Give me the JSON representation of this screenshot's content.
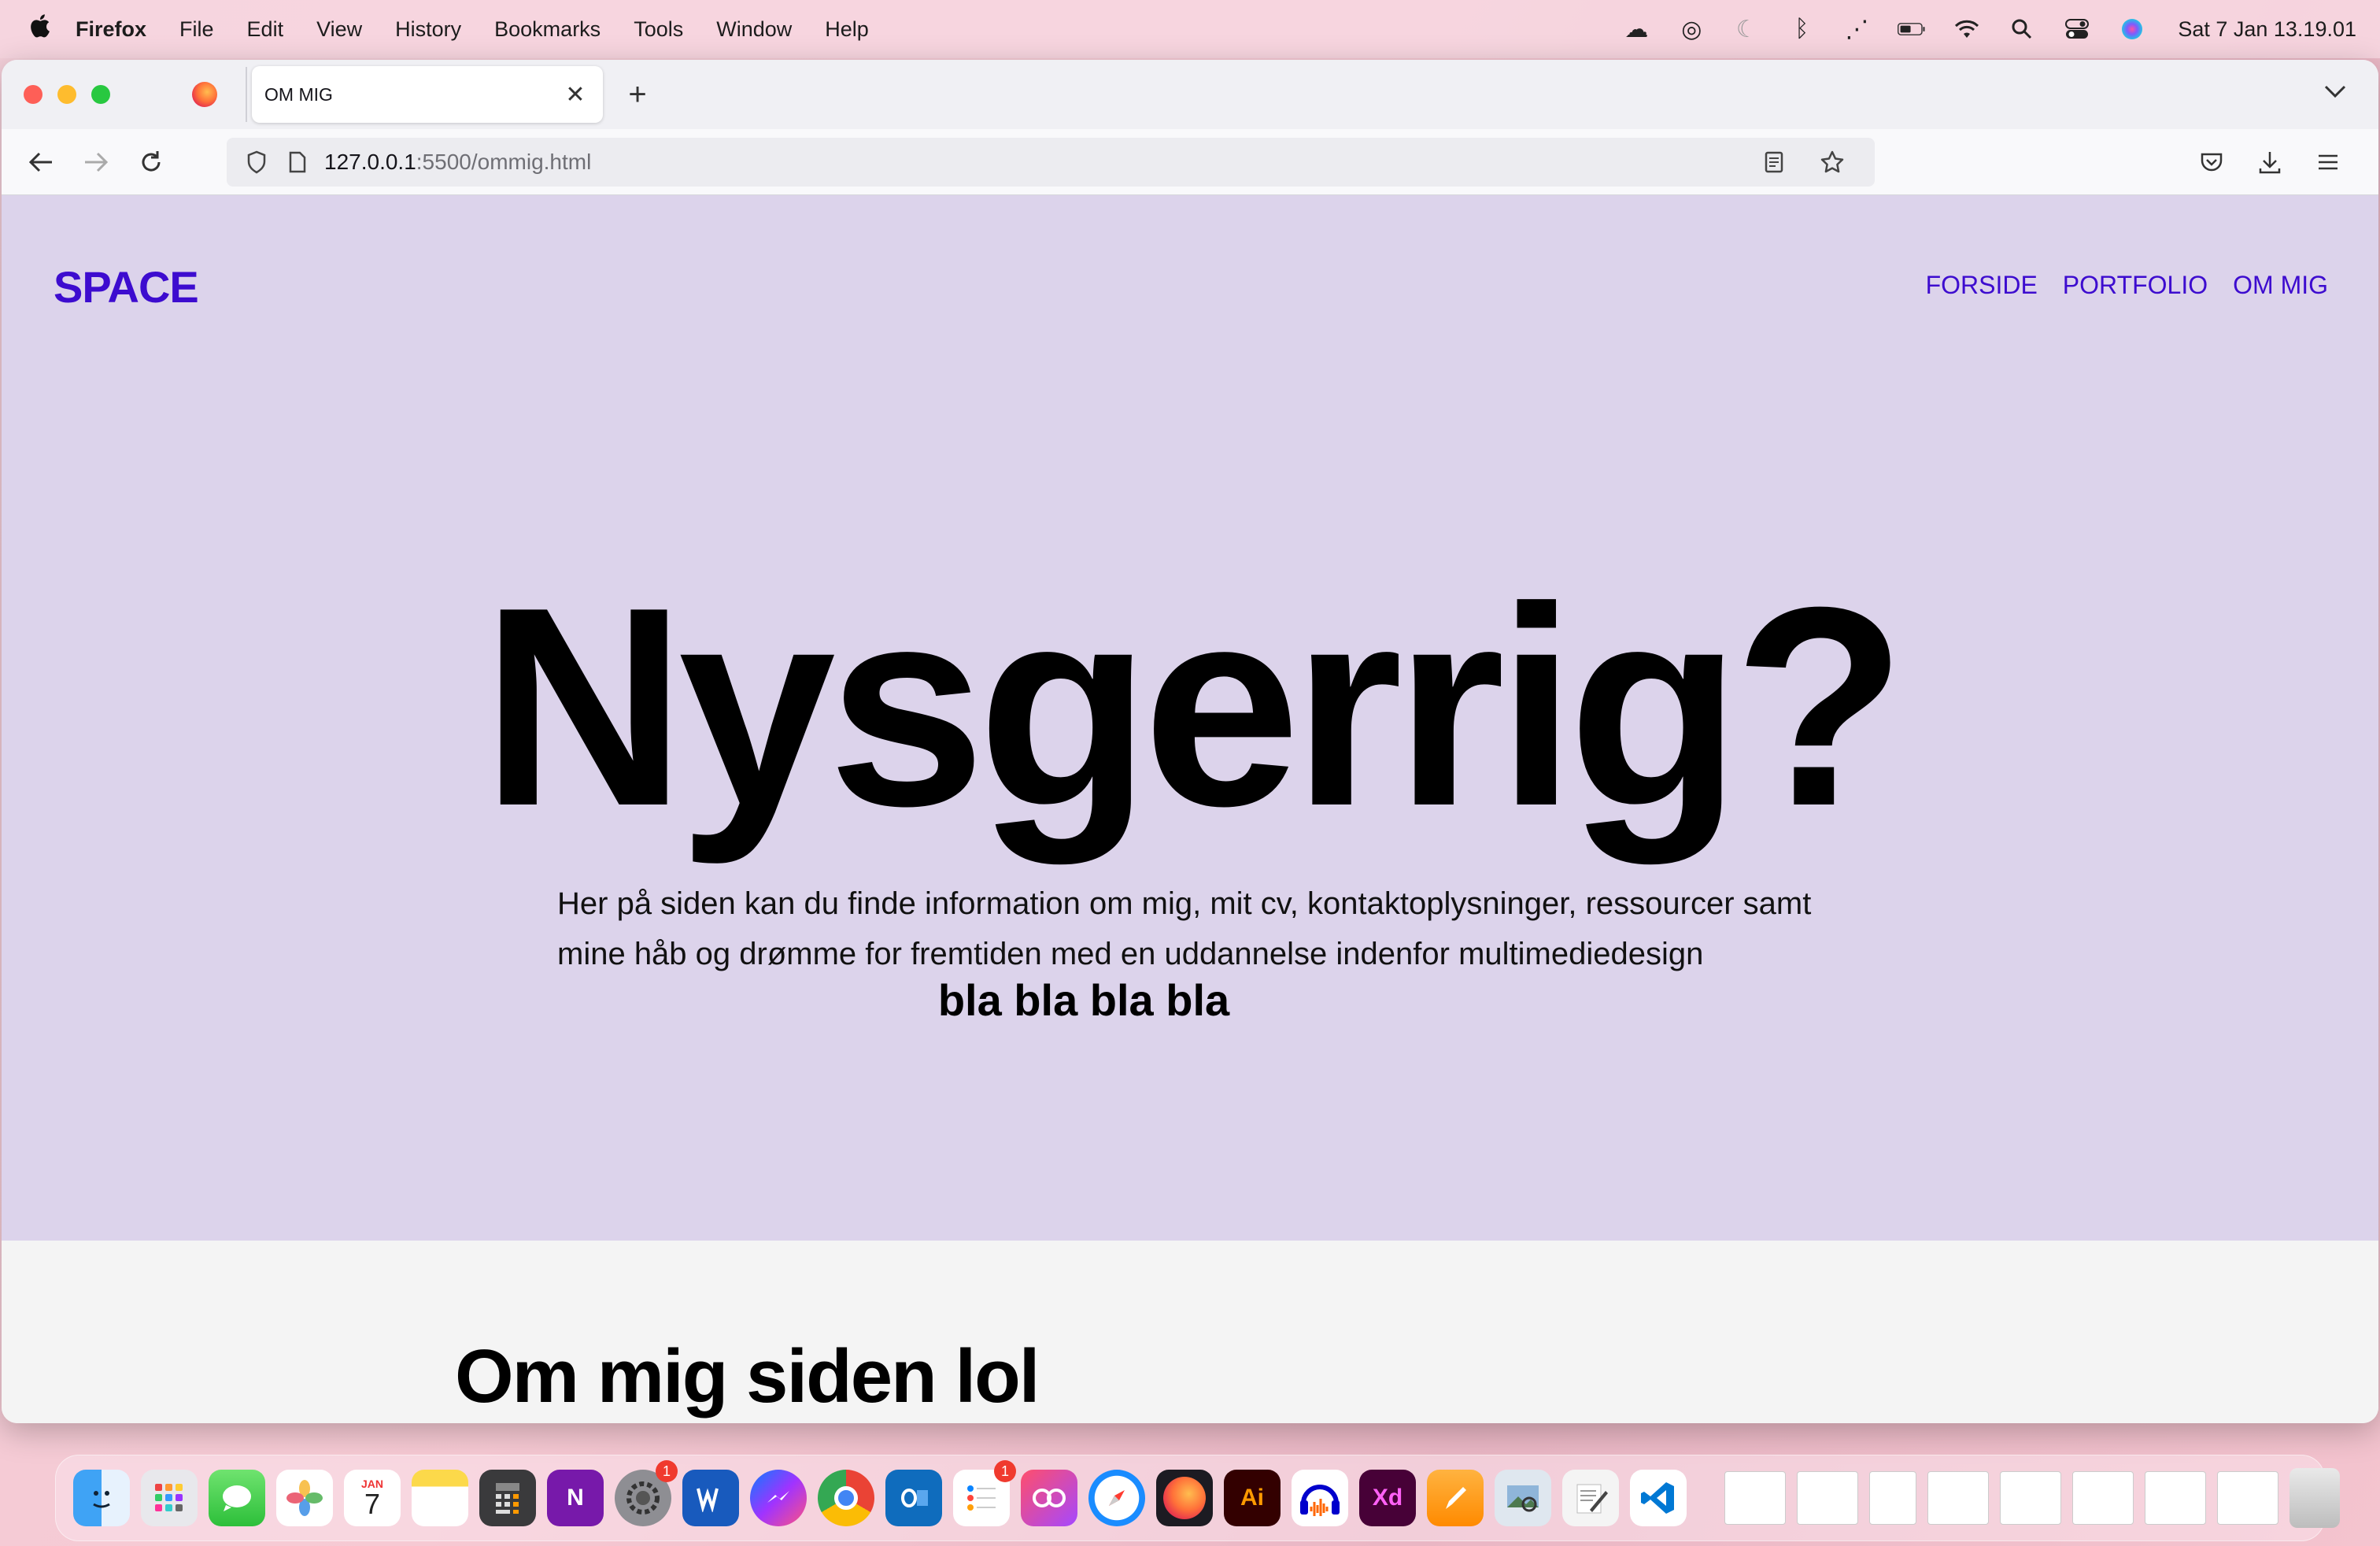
{
  "menubar": {
    "apple": "",
    "app_name": "Firefox",
    "items": [
      "File",
      "Edit",
      "View",
      "History",
      "Bookmarks",
      "Tools",
      "Window",
      "Help"
    ],
    "clock": "Sat 7 Jan  13.19.01"
  },
  "browser": {
    "tab_title": "OM MIG",
    "tab_close": "✕",
    "new_tab": "+",
    "url_host": "127.0.0.1",
    "url_path": ":5500/ommig.html"
  },
  "site": {
    "logo": "SPACE",
    "nav": [
      "FORSIDE",
      "PORTFOLIO",
      "OM MIG"
    ],
    "hero_title": "Nysgerrig?",
    "hero_text": "Her på siden kan du finde information om mig, mit cv, kontaktoplysninger, ressourcer samt mine håb og drømme for fremtiden med en uddannelse indenfor multimediedesign",
    "hero_strong": "bla bla bla bla",
    "section_heading": "Om mig siden lol"
  },
  "dock": {
    "calendar_month": "JAN",
    "calendar_day": "7",
    "settings_badge": "1",
    "reminders_badge": "1",
    "illustrator_label": "Ai",
    "xd_label": "Xd",
    "onenote_label": "N"
  },
  "colors": {
    "hero_bg": "#dcd3eb",
    "accent": "#3d0ccf",
    "section_bg": "#f4f4f4"
  }
}
